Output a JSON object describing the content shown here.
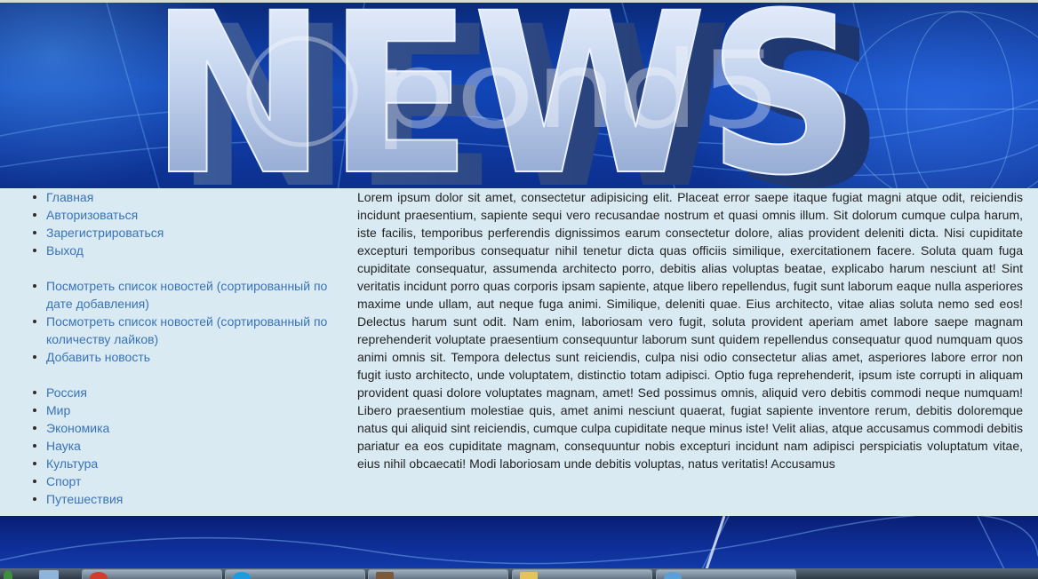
{
  "banner": {
    "title": "NEWS",
    "watermark": "pond5"
  },
  "sidebar": {
    "groups": [
      {
        "items": [
          "Главная",
          "Авторизоваться",
          "Зарегистрироваться",
          "Выход"
        ]
      },
      {
        "items": [
          "Посмотреть список новостей (сортированный по дате добавления)",
          "Посмотреть список новостей (сортированный по количеству лайков)",
          "Добавить новость"
        ]
      },
      {
        "items": [
          "Россия",
          "Мир",
          "Экономика",
          "Наука",
          "Культура",
          "Спорт",
          "Путешествия"
        ]
      }
    ]
  },
  "main": {
    "text": "Lorem ipsum dolor sit amet, consectetur adipisicing elit. Placeat error saepe itaque fugiat magni atque odit, reiciendis incidunt praesentium, sapiente sequi vero recusandae nostrum et quasi omnis illum. Sit dolorum cumque culpa harum, iste facilis, temporibus perferendis dignissimos earum consectetur dolore, alias provident deleniti dicta. Nisi cupiditate excepturi temporibus consequatur nihil tenetur dicta quas officiis similique, exercitationem facere. Soluta quam fuga cupiditate consequatur, assumenda architecto porro, debitis alias voluptas beatae, explicabo harum nesciunt at! Sint veritatis incidunt porro quas corporis ipsam sapiente, atque libero repellendus, fugit sunt laborum eaque nulla asperiores maxime unde ullam, aut neque fuga animi. Similique, deleniti quae. Eius architecto, vitae alias soluta nemo sed eos! Delectus harum sunt odit. Nam enim, laboriosam vero fugit, soluta provident aperiam amet labore saepe magnam reprehenderit voluptate praesentium consequuntur laborum sunt quidem repellendus consequatur quod numquam quos animi omnis sit. Tempora delectus sunt reiciendis, culpa nisi odio consectetur alias amet, asperiores labore error non fugit iusto architecto, unde voluptatem, distinctio totam adipisci. Optio fuga reprehenderit, ipsum iste corrupti in aliquam provident quasi dolore voluptates magnam, amet! Sed possimus omnis, aliquid vero debitis commodi neque numquam! Libero praesentium molestiae quis, amet animi nesciunt quaerat, fugiat sapiente inventore rerum, debitis doloremque natus qui aliquid sint reiciendis, cumque culpa cupiditate neque minus iste! Velit alias, atque accusamus commodi debitis pariatur ea eos cupiditate magnam, consequuntur nobis excepturi incidunt nam adipisci perspiciatis voluptatum vitae, eius nihil obcaecati! Modi laboriosam unde debitis voluptas, natus veritatis! Accusamus"
  },
  "taskbar": {
    "icons": [
      "start-orb-icon",
      "file-icon",
      "chrome-icon",
      "skype-icon",
      "app-icon",
      "folder-icon",
      "app-icon"
    ]
  },
  "colors": {
    "link": "#3a73b4",
    "content_bg": "#d9eaf3",
    "text": "#222222",
    "banner_blue": "#1146b8"
  }
}
